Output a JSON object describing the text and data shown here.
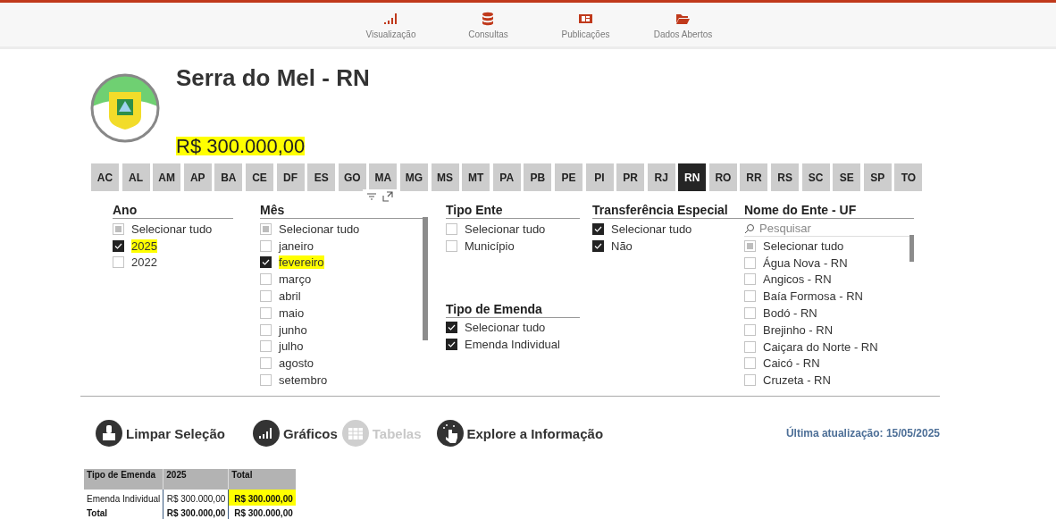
{
  "nav": {
    "items": [
      {
        "label": "Visualização",
        "kind": "signal"
      },
      {
        "label": "Consultas",
        "kind": "database"
      },
      {
        "label": "Publicações",
        "kind": "newspaper"
      },
      {
        "label": "Dados Abertos",
        "kind": "folder"
      }
    ]
  },
  "entity": {
    "name": "Serra do Mel - RN",
    "value": "R$ 300.000,00",
    "value_highlighted": true
  },
  "states": [
    {
      "label": "AC",
      "selected": false
    },
    {
      "label": "AL",
      "selected": false
    },
    {
      "label": "AM",
      "selected": false
    },
    {
      "label": "AP",
      "selected": false
    },
    {
      "label": "BA",
      "selected": false
    },
    {
      "label": "CE",
      "selected": false
    },
    {
      "label": "DF",
      "selected": false
    },
    {
      "label": "ES",
      "selected": false
    },
    {
      "label": "GO",
      "selected": false
    },
    {
      "label": "MA",
      "selected": false
    },
    {
      "label": "MG",
      "selected": false
    },
    {
      "label": "MS",
      "selected": false
    },
    {
      "label": "MT",
      "selected": false
    },
    {
      "label": "PA",
      "selected": false
    },
    {
      "label": "PB",
      "selected": false
    },
    {
      "label": "PE",
      "selected": false
    },
    {
      "label": "PI",
      "selected": false
    },
    {
      "label": "PR",
      "selected": false
    },
    {
      "label": "RJ",
      "selected": false
    },
    {
      "label": "RN",
      "selected": true
    },
    {
      "label": "RO",
      "selected": false
    },
    {
      "label": "RR",
      "selected": false
    },
    {
      "label": "RS",
      "selected": false
    },
    {
      "label": "SC",
      "selected": false
    },
    {
      "label": "SE",
      "selected": false
    },
    {
      "label": "SP",
      "selected": false
    },
    {
      "label": "TO",
      "selected": false
    }
  ],
  "filter_columns": [
    [
      {
        "title": "Ano",
        "items": [
          {
            "label": "Selecionar tudo",
            "checked": false,
            "indeterminate": true,
            "highlighted": false
          },
          {
            "label": "2025",
            "checked": true,
            "indeterminate": false,
            "highlighted": true
          },
          {
            "label": "2022",
            "checked": false,
            "indeterminate": false,
            "highlighted": false
          }
        ]
      }
    ],
    [
      {
        "title": "Mês",
        "scrollable": true,
        "items": [
          {
            "label": "Selecionar tudo",
            "checked": false,
            "indeterminate": true,
            "highlighted": false
          },
          {
            "label": "janeiro",
            "checked": false,
            "indeterminate": false,
            "highlighted": false
          },
          {
            "label": "fevereiro",
            "checked": true,
            "indeterminate": false,
            "highlighted": true
          },
          {
            "label": "março",
            "checked": false,
            "indeterminate": false,
            "highlighted": false
          },
          {
            "label": "abril",
            "checked": false,
            "indeterminate": false,
            "highlighted": false
          },
          {
            "label": "maio",
            "checked": false,
            "indeterminate": false,
            "highlighted": false
          },
          {
            "label": "junho",
            "checked": false,
            "indeterminate": false,
            "highlighted": false
          },
          {
            "label": "julho",
            "checked": false,
            "indeterminate": false,
            "highlighted": false
          },
          {
            "label": "agosto",
            "checked": false,
            "indeterminate": false,
            "highlighted": false
          },
          {
            "label": "setembro",
            "checked": false,
            "indeterminate": false,
            "highlighted": false
          }
        ]
      }
    ],
    [
      {
        "title": "Tipo Ente",
        "items": [
          {
            "label": "Selecionar tudo",
            "checked": false,
            "indeterminate": false,
            "highlighted": false
          },
          {
            "label": "Município",
            "checked": false,
            "indeterminate": false,
            "highlighted": false
          }
        ]
      },
      {
        "title": "Tipo de Emenda",
        "items": [
          {
            "label": "Selecionar tudo",
            "checked": true,
            "indeterminate": false,
            "highlighted": false
          },
          {
            "label": "Emenda Individual",
            "checked": true,
            "indeterminate": false,
            "highlighted": false
          }
        ]
      }
    ],
    [
      {
        "title": "Transferência Especial",
        "items": [
          {
            "label": "Selecionar tudo",
            "checked": true,
            "indeterminate": false,
            "highlighted": false
          },
          {
            "label": "Não",
            "checked": true,
            "indeterminate": false,
            "highlighted": false
          }
        ]
      }
    ],
    [
      {
        "title": "Nome do Ente - UF",
        "search": {
          "placeholder": "Pesquisar"
        },
        "scrollable": true,
        "items": [
          {
            "label": "Selecionar tudo",
            "checked": false,
            "indeterminate": true,
            "highlighted": false
          },
          {
            "label": "Água Nova - RN",
            "checked": false,
            "indeterminate": false,
            "highlighted": false
          },
          {
            "label": "Angicos - RN",
            "checked": false,
            "indeterminate": false,
            "highlighted": false
          },
          {
            "label": "Baía Formosa - RN",
            "checked": false,
            "indeterminate": false,
            "highlighted": false
          },
          {
            "label": "Bodó - RN",
            "checked": false,
            "indeterminate": false,
            "highlighted": false
          },
          {
            "label": "Brejinho - RN",
            "checked": false,
            "indeterminate": false,
            "highlighted": false
          },
          {
            "label": "Caiçara do Norte - RN",
            "checked": false,
            "indeterminate": false,
            "highlighted": false
          },
          {
            "label": "Caicó - RN",
            "checked": false,
            "indeterminate": false,
            "highlighted": false
          },
          {
            "label": "Cruzeta - RN",
            "checked": false,
            "indeterminate": false,
            "highlighted": false
          }
        ]
      }
    ]
  ],
  "actions": [
    {
      "label": "Limpar Seleção",
      "kind": "brush",
      "disabled": false
    },
    {
      "label": "Gráficos",
      "kind": "chart",
      "disabled": false
    },
    {
      "label": "Tabelas",
      "kind": "table",
      "disabled": true
    },
    {
      "label": "Explore a Informação",
      "kind": "touch",
      "disabled": false
    }
  ],
  "last_update": "Última atualização: 15/05/2025",
  "table": {
    "columns": [
      "Tipo de Emenda",
      "2025",
      "Total"
    ],
    "rows": [
      {
        "kind": "data",
        "cells": [
          {
            "text": "Emenda Individual",
            "highlighted": false
          },
          {
            "text": "R$ 300.000,00",
            "highlighted": false
          },
          {
            "text": "R$ 300.000,00",
            "highlighted": true
          }
        ]
      },
      {
        "kind": "total",
        "cells": [
          {
            "text": "Total",
            "highlighted": false
          },
          {
            "text": "R$ 300.000,00",
            "highlighted": false
          },
          {
            "text": "R$ 300.000,00",
            "highlighted": false
          }
        ]
      }
    ]
  }
}
